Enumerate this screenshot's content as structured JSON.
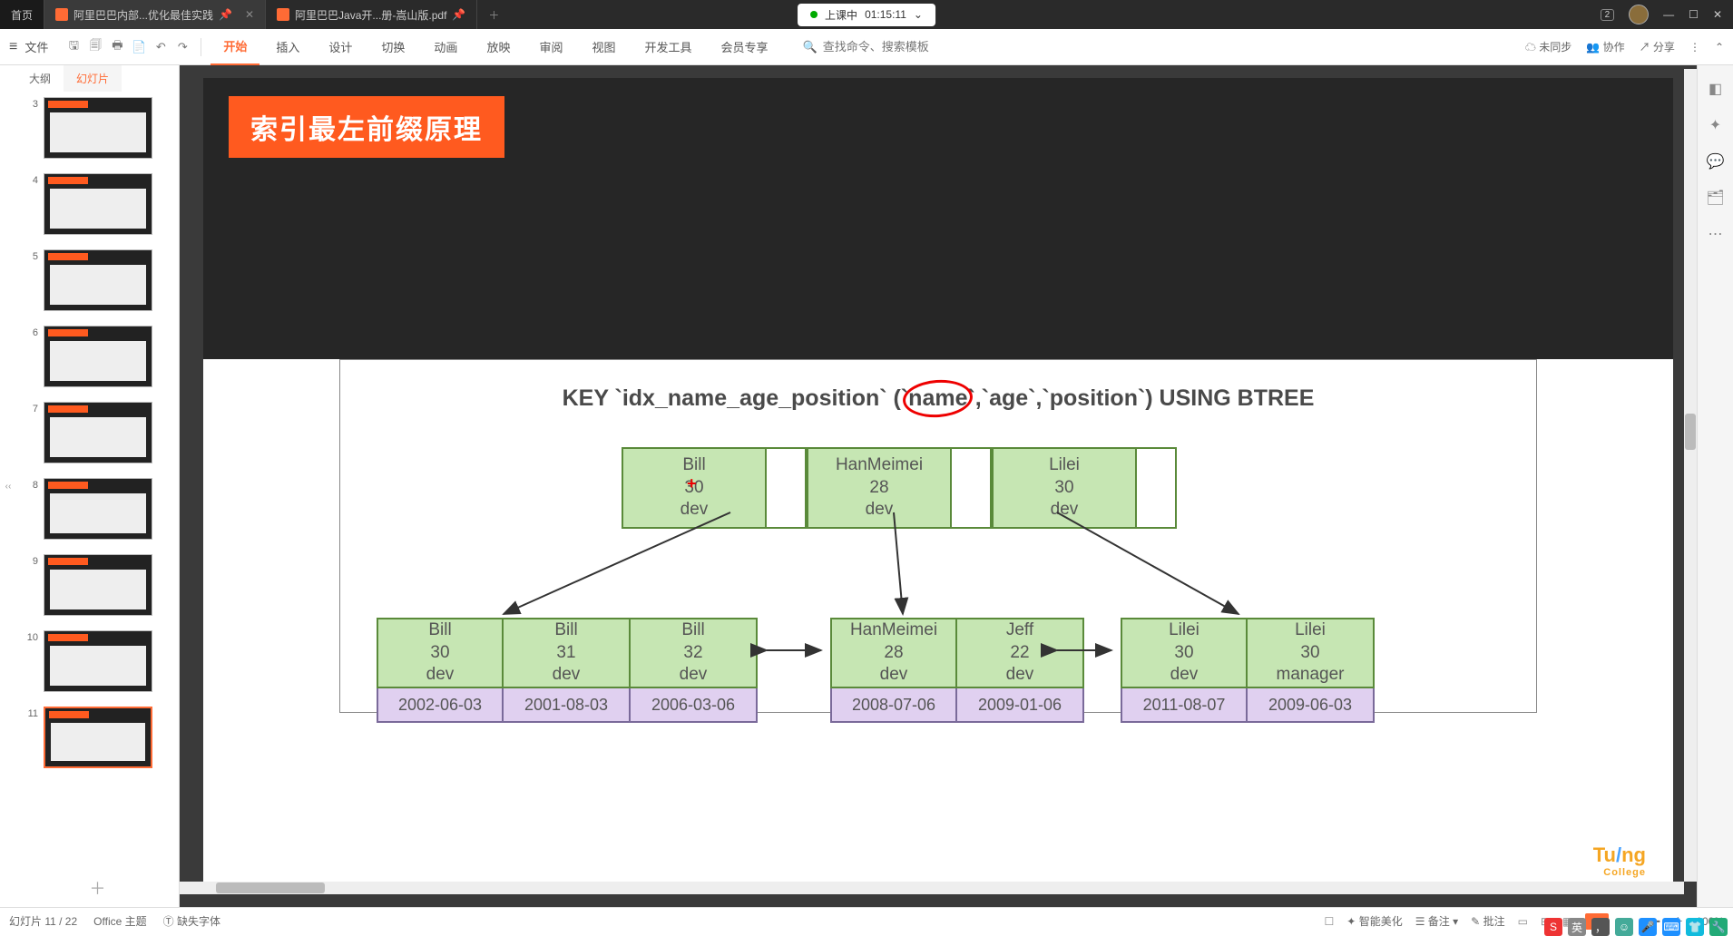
{
  "titlebar": {
    "home": "首页",
    "tab1": "阿里巴巴内部...优化最佳实践",
    "tab2": "阿里巴巴Java开...册-嵩山版.pdf",
    "recording_label": "上课中",
    "recording_time": "01:15:11",
    "badge": "2"
  },
  "ribbon": {
    "file": "文件",
    "tabs": [
      "开始",
      "插入",
      "设计",
      "切换",
      "动画",
      "放映",
      "审阅",
      "视图",
      "开发工具",
      "会员专享"
    ],
    "search_placeholder": "查找命令、搜索模板",
    "unsync": "未同步",
    "collab": "协作",
    "share": "分享"
  },
  "thumb_panel": {
    "outline": "大纲",
    "slides": "幻灯片"
  },
  "thumbs": [
    3,
    4,
    5,
    6,
    7,
    8,
    9,
    10,
    11
  ],
  "current_thumb": 11,
  "slide": {
    "title": "索引最左前缀原理",
    "sql_pre": "KEY `idx_name_age_position` (`",
    "sql_name": "name",
    "sql_mid": "`,`age`,`position`) USING BTREE",
    "root_nodes": [
      {
        "name": "Bill",
        "age": "30",
        "pos": "dev"
      },
      {
        "name": "HanMeimei",
        "age": "28",
        "pos": "dev"
      },
      {
        "name": "Lilei",
        "age": "30",
        "pos": "dev"
      }
    ],
    "leaf_groups": [
      {
        "nodes": [
          {
            "name": "Bill",
            "age": "30",
            "pos": "dev"
          },
          {
            "name": "Bill",
            "age": "31",
            "pos": "dev"
          },
          {
            "name": "Bill",
            "age": "32",
            "pos": "dev"
          }
        ],
        "dates": [
          "2002-06-03",
          "2001-08-03",
          "2006-03-06"
        ]
      },
      {
        "nodes": [
          {
            "name": "HanMeimei",
            "age": "28",
            "pos": "dev"
          },
          {
            "name": "Jeff",
            "age": "22",
            "pos": "dev"
          }
        ],
        "dates": [
          "2008-07-06",
          "2009-01-06"
        ]
      },
      {
        "nodes": [
          {
            "name": "Lilei",
            "age": "30",
            "pos": "dev"
          },
          {
            "name": "Lilei",
            "age": "30",
            "pos": "manager"
          }
        ],
        "dates": [
          "2011-08-07",
          "2009-06-03"
        ]
      }
    ],
    "logo": {
      "p1": "Tu",
      "p2": "/",
      "p3": "ng",
      "sub": "College"
    }
  },
  "statusbar": {
    "slide_counter": "幻灯片 11 / 22",
    "theme": "Office 主题",
    "missing_font": "缺失字体",
    "beautify": "智能美化",
    "notes": "备注",
    "comments": "批注",
    "zoom": "100%"
  },
  "tray": {
    "ime1": "S",
    "ime2": "英"
  }
}
